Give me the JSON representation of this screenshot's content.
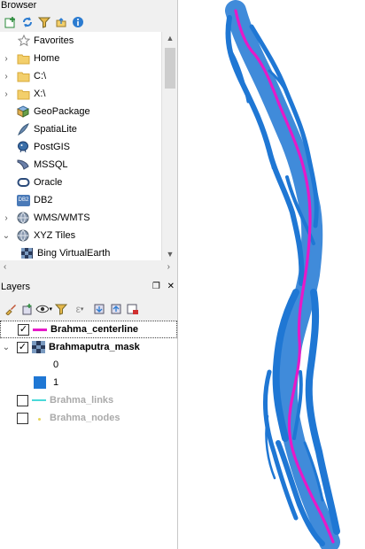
{
  "browser": {
    "title": "Browser",
    "items": [
      {
        "label": "Favorites",
        "icon": "star-icon",
        "expander": ""
      },
      {
        "label": "Home",
        "icon": "folder-icon",
        "expander": "›"
      },
      {
        "label": "C:\\",
        "icon": "folder-icon",
        "expander": "›"
      },
      {
        "label": "X:\\",
        "icon": "folder-icon",
        "expander": "›"
      },
      {
        "label": "GeoPackage",
        "icon": "geopackage-icon",
        "expander": ""
      },
      {
        "label": "SpatiaLite",
        "icon": "spatialite-icon",
        "expander": ""
      },
      {
        "label": "PostGIS",
        "icon": "postgis-icon",
        "expander": ""
      },
      {
        "label": "MSSQL",
        "icon": "mssql-icon",
        "expander": ""
      },
      {
        "label": "Oracle",
        "icon": "oracle-icon",
        "expander": ""
      },
      {
        "label": "DB2",
        "icon": "db2-icon",
        "expander": ""
      },
      {
        "label": "WMS/WMTS",
        "icon": "globe-icon",
        "expander": "›"
      },
      {
        "label": "XYZ Tiles",
        "icon": "globe-icon",
        "expander": "⌄"
      },
      {
        "label": "Bing VirtualEarth",
        "icon": "tile-layer-icon",
        "expander": ""
      }
    ],
    "db2_badge": "DB2"
  },
  "layers": {
    "title": "Layers",
    "items": [
      {
        "name": "Brahma_centerline",
        "type": "line",
        "color": "#e619c8",
        "checked": true,
        "enabled": true
      },
      {
        "name": "Brahmaputra_mask",
        "type": "raster",
        "checked": true,
        "enabled": true
      },
      {
        "name": "0",
        "type": "legend-class"
      },
      {
        "name": "1",
        "type": "legend-class",
        "color": "#1f77d4"
      },
      {
        "name": "Brahma_links",
        "type": "line",
        "color": "#4ad9d9",
        "checked": false,
        "enabled": false
      },
      {
        "name": "Brahma_nodes",
        "type": "point",
        "color": "#e6d35a",
        "checked": false,
        "enabled": false
      }
    ]
  },
  "colors": {
    "river_mask": "#1f77d4",
    "centerline": "#e619c8",
    "folder": "#f3cf6b"
  }
}
